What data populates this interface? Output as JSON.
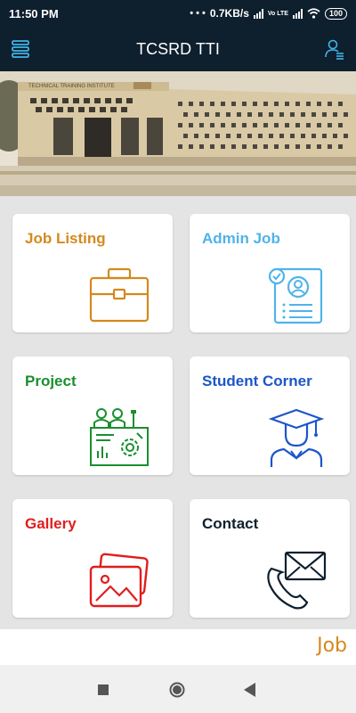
{
  "status": {
    "time": "11:50 PM",
    "net_speed": "0.7KB/s",
    "volte": "Vo LTE",
    "battery": "100"
  },
  "appbar": {
    "title": "TCSRD TTI"
  },
  "banner": {
    "sign_text": "TECHNICAL TRAINING INSTITUTE"
  },
  "cards": [
    {
      "label": "Job Listing",
      "color": "#d4891e",
      "icon": "briefcase-icon"
    },
    {
      "label": "Admin Job",
      "color": "#4fb3ea",
      "icon": "id-card-check-icon"
    },
    {
      "label": "Project",
      "color": "#1a8f2e",
      "icon": "project-team-icon"
    },
    {
      "label": "Student Corner",
      "color": "#1c56c9",
      "icon": "graduate-icon"
    },
    {
      "label": "Gallery",
      "color": "#e11d1d",
      "icon": "gallery-photos-icon"
    },
    {
      "label": "Contact",
      "color": "#0e1f2e",
      "icon": "phone-mail-icon"
    }
  ],
  "footer": {
    "link": "Job"
  }
}
